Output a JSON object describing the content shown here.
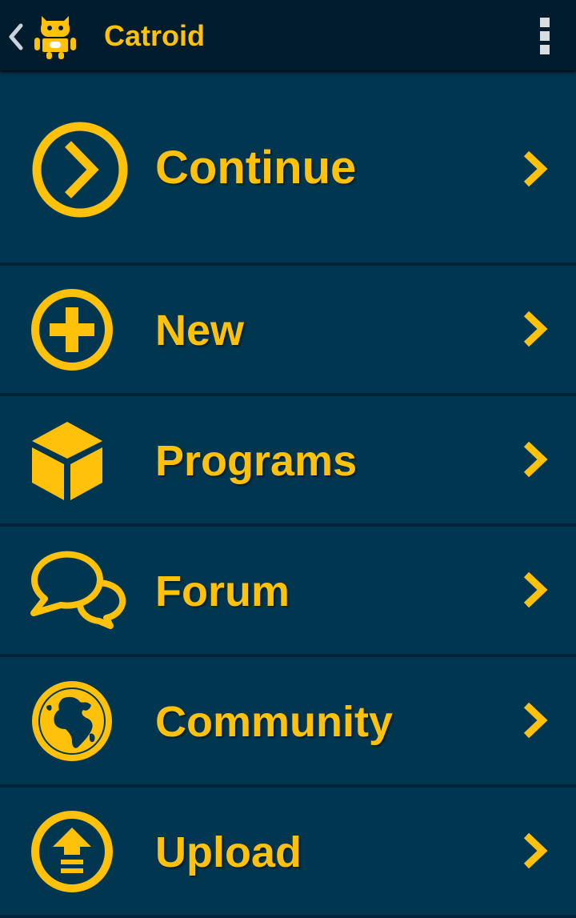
{
  "app_bar": {
    "title": "Catroid",
    "back_icon": "chevron-left-icon",
    "logo_icon": "catroid-cat-logo",
    "overflow_icon": "more-vertical-icon"
  },
  "colors": {
    "accent": "#ffc10a",
    "appbar_bg": "#011c2c",
    "item_bg": "#003650",
    "divider": "#00243a"
  },
  "menu": {
    "items": [
      {
        "label": "Continue",
        "icon": "play-circle-icon"
      },
      {
        "label": "New",
        "icon": "plus-circle-icon"
      },
      {
        "label": "Programs",
        "icon": "cube-icon"
      },
      {
        "label": "Forum",
        "icon": "chat-bubbles-icon"
      },
      {
        "label": "Community",
        "icon": "globe-icon"
      },
      {
        "label": "Upload",
        "icon": "upload-circle-icon"
      }
    ],
    "chevron_icon": "chevron-right-icon"
  }
}
